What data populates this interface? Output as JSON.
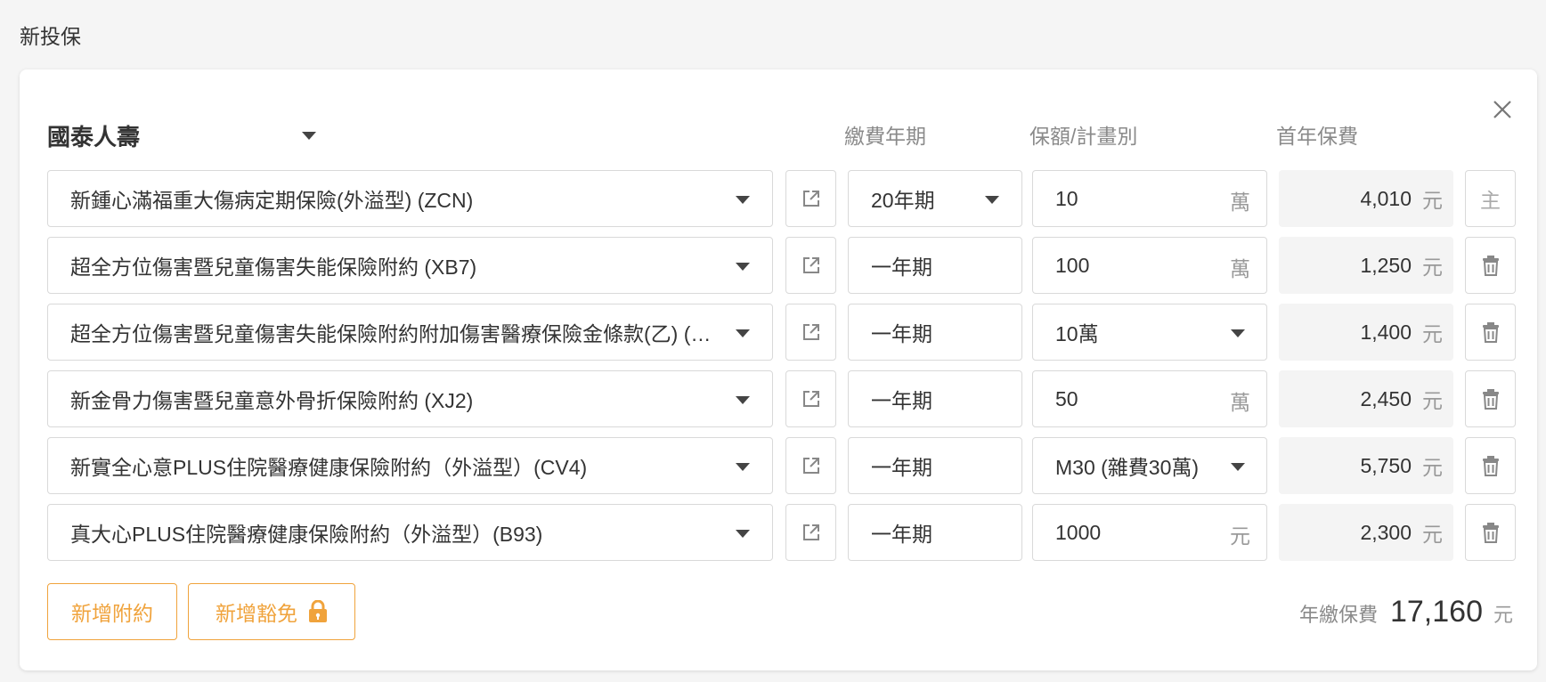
{
  "page": {
    "title": "新投保"
  },
  "insurer": {
    "name": "國泰人壽"
  },
  "columns": {
    "term": "繳費年期",
    "amount": "保額/計畫別",
    "premium": "首年保費"
  },
  "rows": [
    {
      "product": "新鍾心滿福重大傷病定期保險(外溢型) (ZCN)",
      "term": "20年期",
      "term_select": true,
      "amount": "10",
      "amount_unit": "萬",
      "amount_select": false,
      "premium": "4,010",
      "premium_unit": "元",
      "action": "主"
    },
    {
      "product": "超全方位傷害暨兒童傷害失能保險附約 (XB7)",
      "term": "一年期",
      "term_select": false,
      "amount": "100",
      "amount_unit": "萬",
      "amount_select": false,
      "premium": "1,250",
      "premium_unit": "元",
      "action": "delete"
    },
    {
      "product": "超全方位傷害暨兒童傷害失能保險附約附加傷害醫療保險金條款(乙) (…",
      "term": "一年期",
      "term_select": false,
      "amount": "10萬",
      "amount_unit": "",
      "amount_select": true,
      "premium": "1,400",
      "premium_unit": "元",
      "action": "delete"
    },
    {
      "product": "新金骨力傷害暨兒童意外骨折保險附約 (XJ2)",
      "term": "一年期",
      "term_select": false,
      "amount": "50",
      "amount_unit": "萬",
      "amount_select": false,
      "premium": "2,450",
      "premium_unit": "元",
      "action": "delete"
    },
    {
      "product": "新實全心意PLUS住院醫療健康保險附約（外溢型）(CV4)",
      "term": "一年期",
      "term_select": false,
      "amount": "M30 (雜費30萬)",
      "amount_unit": "",
      "amount_select": true,
      "premium": "5,750",
      "premium_unit": "元",
      "action": "delete"
    },
    {
      "product": "真大心PLUS住院醫療健康保險附約（外溢型）(B93)",
      "term": "一年期",
      "term_select": false,
      "amount": "1000",
      "amount_unit": "元",
      "amount_select": false,
      "premium": "2,300",
      "premium_unit": "元",
      "action": "delete"
    }
  ],
  "buttons": {
    "add_rider": "新增附約",
    "add_waiver": "新增豁免"
  },
  "total": {
    "label": "年繳保費",
    "value": "17,160",
    "unit": "元"
  },
  "colors": {
    "accent": "#f0a33c",
    "border": "#d9d9d9",
    "muted": "#8a8a8a"
  },
  "icons": {
    "close": "close-icon",
    "open_link": "external-link-icon",
    "delete": "trash-icon",
    "lock": "lock-icon",
    "dropdown": "caret-down-icon"
  }
}
